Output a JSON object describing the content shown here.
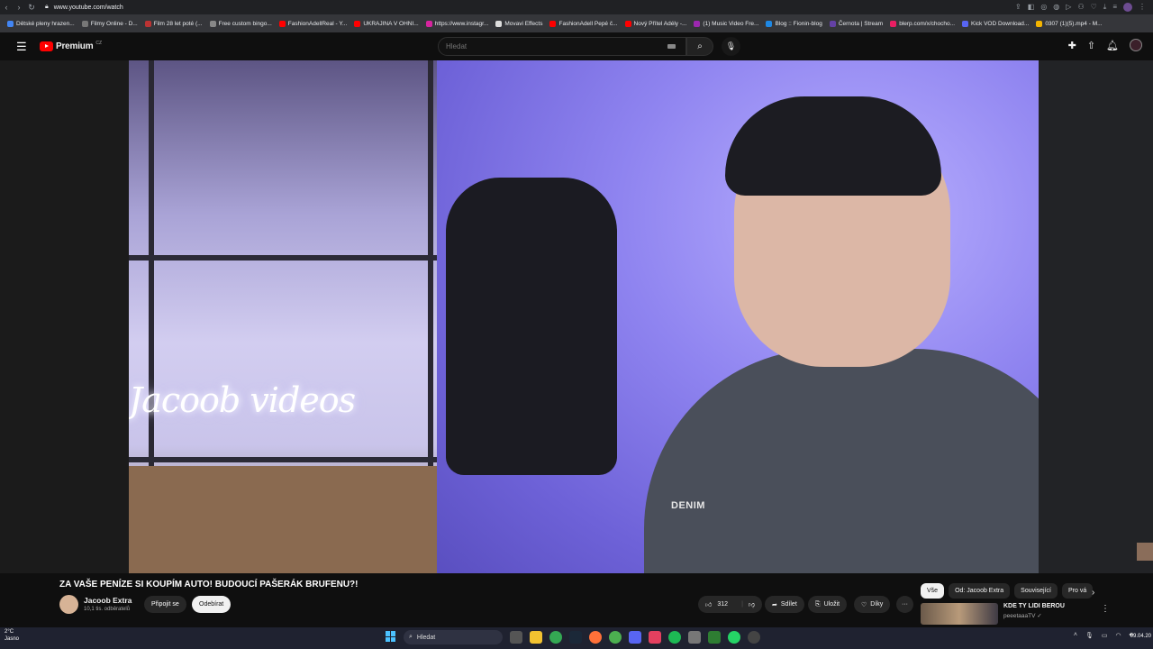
{
  "browser": {
    "url": "www.youtube.com/watch",
    "bookmarks": [
      "Dětské pleny hrazen...",
      "Filmy Online - D...",
      "Film 28 let poté (...",
      "Free custom bingo...",
      "FashionAdellReal - Y...",
      "UKRAJINA V OHNI...",
      "https://www.instagr...",
      "Movavi Effects",
      "FashionAdell Pepé č...",
      "Nový Přítel Adély -...",
      "(1) Music Video Fre...",
      "Blog :: Fionin-blog",
      "Černota | Stream",
      "blerp.com/x/chocho...",
      "Kick VOD Download...",
      "0307 (1)(5).mp4 - M..."
    ]
  },
  "header": {
    "logo_text": "Premium",
    "region": "CZ",
    "search_placeholder": "Hledat"
  },
  "player": {
    "neon_text": "Jacoob videos",
    "shirt_text": "DENIM"
  },
  "video": {
    "title": "ZA VAŠE PENÍZE SI KOUPÍM AUTO! BUDOUCÍ PAŠERÁK BRUFENU?!",
    "channel_name": "Jacoob Extra",
    "subscribers": "10,1 tis. odběratelů",
    "join_label": "Připojit se",
    "subscribe_label": "Odebírat",
    "likes": "312",
    "share_label": "Sdílet",
    "save_label": "Uložit",
    "thanks_label": "Díky",
    "more_label": "···"
  },
  "sidebar": {
    "chips": [
      "Vše",
      "Od: Jacoob Extra",
      "Související",
      "Pro vá"
    ],
    "recommended": {
      "title": "KDE TY LIDI BEROU",
      "channel": "peeetaaaTV"
    }
  },
  "taskbar": {
    "weather_temp": "2°C",
    "weather_desc": "Jasno",
    "search_label": "Hledat",
    "date": "09.04.20"
  },
  "colors": {
    "brand_red": "#ff0000",
    "background": "#0f0f0f",
    "chip_active": "#f1f1f1"
  }
}
